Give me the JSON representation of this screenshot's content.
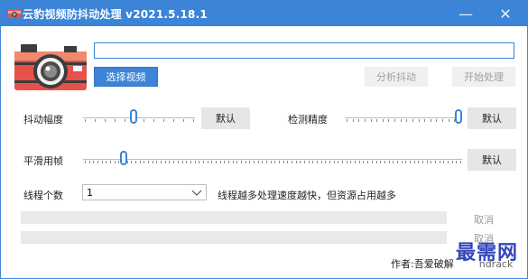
{
  "window": {
    "title": "云豹视频防抖动处理 v2021.5.18.1",
    "minimize_glyph": "—",
    "close_glyph": "✕",
    "accent": "#3b84d8"
  },
  "top": {
    "path_input_value": "",
    "select_video_label": "选择视频",
    "analyze_label": "分析抖动",
    "process_label": "开始处理"
  },
  "controls": {
    "shake_amplitude_label": "抖动幅度",
    "shake_amplitude_value": 0.45,
    "shake_default_label": "默认",
    "detect_precision_label": "检测精度",
    "detect_precision_value": 1.0,
    "detect_default_label": "默认",
    "smooth_frames_label": "平滑用帧",
    "smooth_frames_value": 0.1,
    "smooth_default_label": "默认",
    "threads_label": "线程个数",
    "threads_value": "1",
    "threads_hint": "线程越多处理速度越快，但资源占用越多"
  },
  "progress": {
    "bar1_value": 0,
    "bar1_cancel_label": "取消",
    "bar2_value": 0,
    "bar2_cancel_label": "取消"
  },
  "footer": {
    "author_label": "作者:吾爱破解",
    "author_suffix": "ndrack",
    "watermark": "最需网"
  },
  "icons": {
    "app": "camera-icon",
    "camera": "camera-logo-icon",
    "chevron": "chevron-down-icon"
  }
}
